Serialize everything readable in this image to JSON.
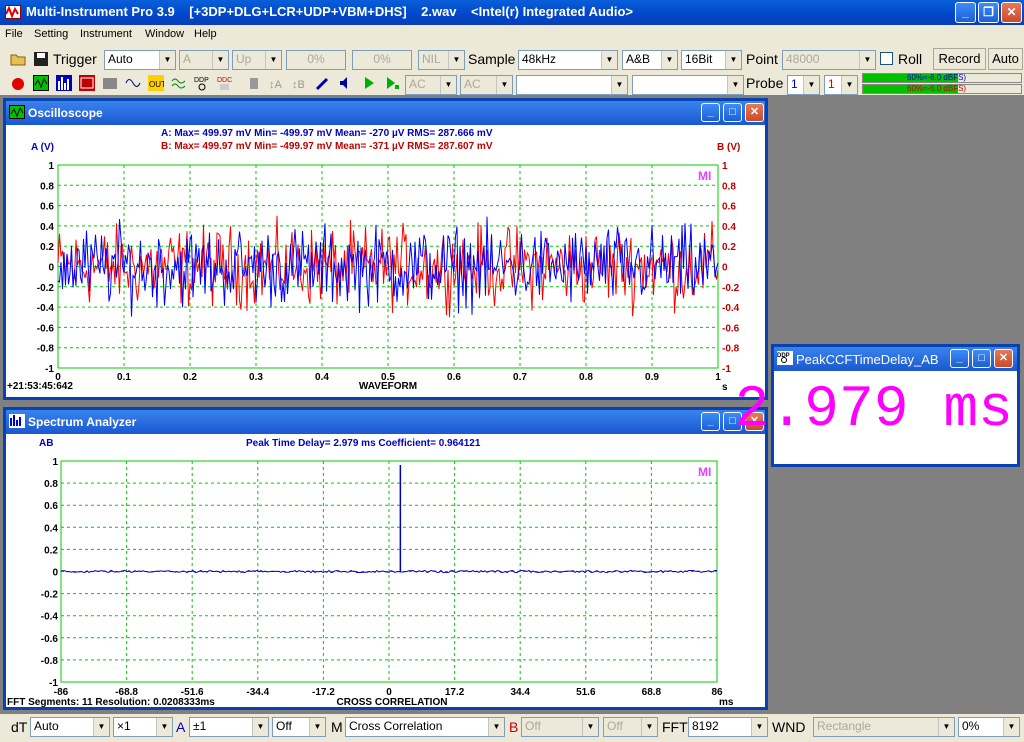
{
  "title": "Multi-Instrument Pro 3.9    [+3DP+DLG+LCR+UDP+VBM+DHS]    2.wav    <Intel(r) Integrated Audio>",
  "menu": [
    "File",
    "Setting",
    "Instrument",
    "Window",
    "Help"
  ],
  "toolbar1": {
    "trigger_label": "Trigger",
    "trigger_mode": "Auto",
    "channel": "A",
    "edge": "Up",
    "level1": "0%",
    "level2": "0%",
    "nil": "NIL",
    "sample_label": "Sample",
    "sample_rate": "48kHz",
    "channels": "A&B",
    "bits": "16Bit",
    "point_label": "Point",
    "points": "48000",
    "roll_label": "Roll",
    "record_label": "Record",
    "auto_label": "Auto"
  },
  "toolbar2": {
    "coupling_a": "AC",
    "coupling_b": "AC",
    "probe_label": "Probe",
    "probe_a": "1",
    "probe_b": "1",
    "meter_a": "60%≈-6.0 dBFS)",
    "meter_b": "60%≈-6.0 dBFS)",
    "colors": {
      "meter_green": "#00c000",
      "meter_a_text": "#0000c0",
      "meter_b_text": "#c00000"
    }
  },
  "osc": {
    "title": "Oscilloscope",
    "stat_a": "A: Max=     499.97  mV  Min=     -499.97  mV  Mean=         -270   µV  RMS=      287.666  mV",
    "stat_b": "B: Max=     499.97  mV  Min=     -499.97  mV  Mean=         -371   µV  RMS=      287.607  mV",
    "ylabel_left": "A (V)",
    "ylabel_right": "B (V)",
    "y_ticks": [
      "1",
      "0.8",
      "0.6",
      "0.4",
      "0.2",
      "0",
      "-0.2",
      "-0.4",
      "-0.6",
      "-0.8",
      "-1"
    ],
    "x_ticks": [
      "0",
      "0.1",
      "0.2",
      "0.3",
      "0.4",
      "0.5",
      "0.6",
      "0.7",
      "0.8",
      "0.9",
      "1"
    ],
    "x_unit": "s",
    "xlabel": "WAVEFORM",
    "timestamp": "+21:53:45:642",
    "logo": "MI",
    "colors": {
      "a": "#0000ff",
      "b": "#ff0000",
      "grid": "#00cc00"
    }
  },
  "spec": {
    "title": "Spectrum Analyzer",
    "ylabel": "AB",
    "info": "Peak Time Delay=     2.979  ms   Coefficient=     0.964121",
    "y_ticks": [
      "1",
      "0.8",
      "0.6",
      "0.4",
      "0.2",
      "0",
      "-0.2",
      "-0.4",
      "-0.6",
      "-0.8",
      "-1"
    ],
    "x_ticks": [
      "-86",
      "-68.8",
      "-51.6",
      "-34.4",
      "-17.2",
      "0",
      "17.2",
      "34.4",
      "51.6",
      "68.8",
      "86"
    ],
    "x_unit": "ms",
    "xlabel": "CROSS CORRELATION",
    "footer": "FFT Segments: 11   Resolution:  0.0208333ms",
    "logo": "MI",
    "peak_value": 0.964121,
    "peak_position_ms": 2.979
  },
  "peak": {
    "title": "PeakCCFTimeDelay_AB",
    "value": "2.979 ms"
  },
  "status": {
    "dt_label": "dT",
    "dt_value": "Auto",
    "mult": "×1",
    "a_label": "A",
    "a_value": "±1",
    "a_func": "Off",
    "m_label": "M",
    "m_value": "Cross Correlation",
    "b_label": "B",
    "b_value": "Off",
    "b_func": "Off",
    "fft_label": "FFT",
    "fft_size": "8192",
    "wnd_label": "WND",
    "window": "Rectangle",
    "overlap": "0%"
  }
}
